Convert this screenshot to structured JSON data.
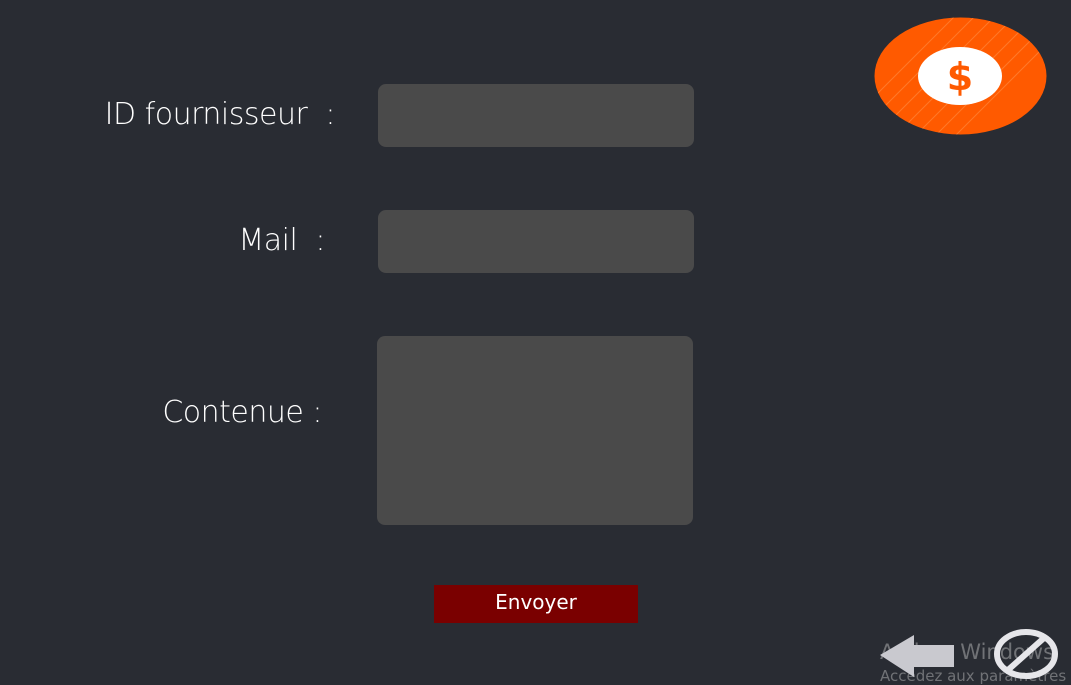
{
  "form": {
    "supplier_id_label": "ID fournisseur  :",
    "mail_label": "Mail  :",
    "content_label": "Contenue :",
    "supplier_id_value": "",
    "mail_value": "",
    "content_value": "",
    "send_label": "Envoyer"
  },
  "logo": {
    "icon": "dollar-icon",
    "symbol": "$",
    "color": "#ff5a00"
  },
  "nav": {
    "back_icon": "left-arrow-icon",
    "cancel_icon": "prohibited-icon"
  },
  "watermark": {
    "title": "Activer Windows",
    "subtitle": "Accédez aux paramètres"
  },
  "colors": {
    "background": "#292c33",
    "field": "#4a4a4a",
    "button": "#7a0000",
    "accent": "#ff5a00"
  }
}
